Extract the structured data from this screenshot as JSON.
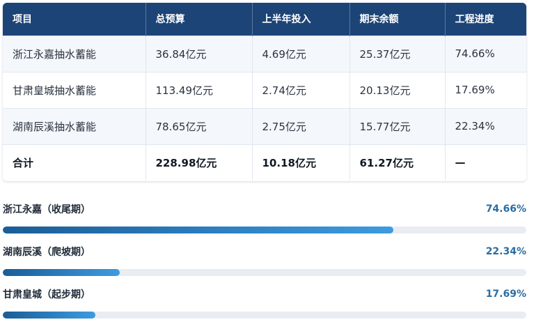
{
  "table": {
    "headers": [
      "项目",
      "总预算",
      "上半年投入",
      "期末余额",
      "工程进度"
    ],
    "rows": [
      [
        "浙江永嘉抽水蓄能",
        "36.84亿元",
        "4.69亿元",
        "25.37亿元",
        "74.66%"
      ],
      [
        "甘肃皇城抽水蓄能",
        "113.49亿元",
        "2.74亿元",
        "20.13亿元",
        "17.69%"
      ],
      [
        "湖南辰溪抽水蓄能",
        "78.65亿元",
        "2.75亿元",
        "15.77亿元",
        "22.34%"
      ]
    ],
    "total": [
      "合计",
      "228.98亿元",
      "10.18亿元",
      "61.27亿元",
      "—"
    ]
  },
  "progress": [
    {
      "label": "浙江永嘉（收尾期）",
      "pct_text": "74.66%",
      "value": 74.66
    },
    {
      "label": "湖南辰溪（爬坡期）",
      "pct_text": "22.34%",
      "value": 22.34
    },
    {
      "label": "甘肃皇城（起步期）",
      "pct_text": "17.69%",
      "value": 17.69
    }
  ],
  "colors": {
    "header_bg": "#1d4476",
    "accent": "#2a6da3",
    "bar_start": "#1a5d97",
    "bar_end": "#3d9be0"
  }
}
